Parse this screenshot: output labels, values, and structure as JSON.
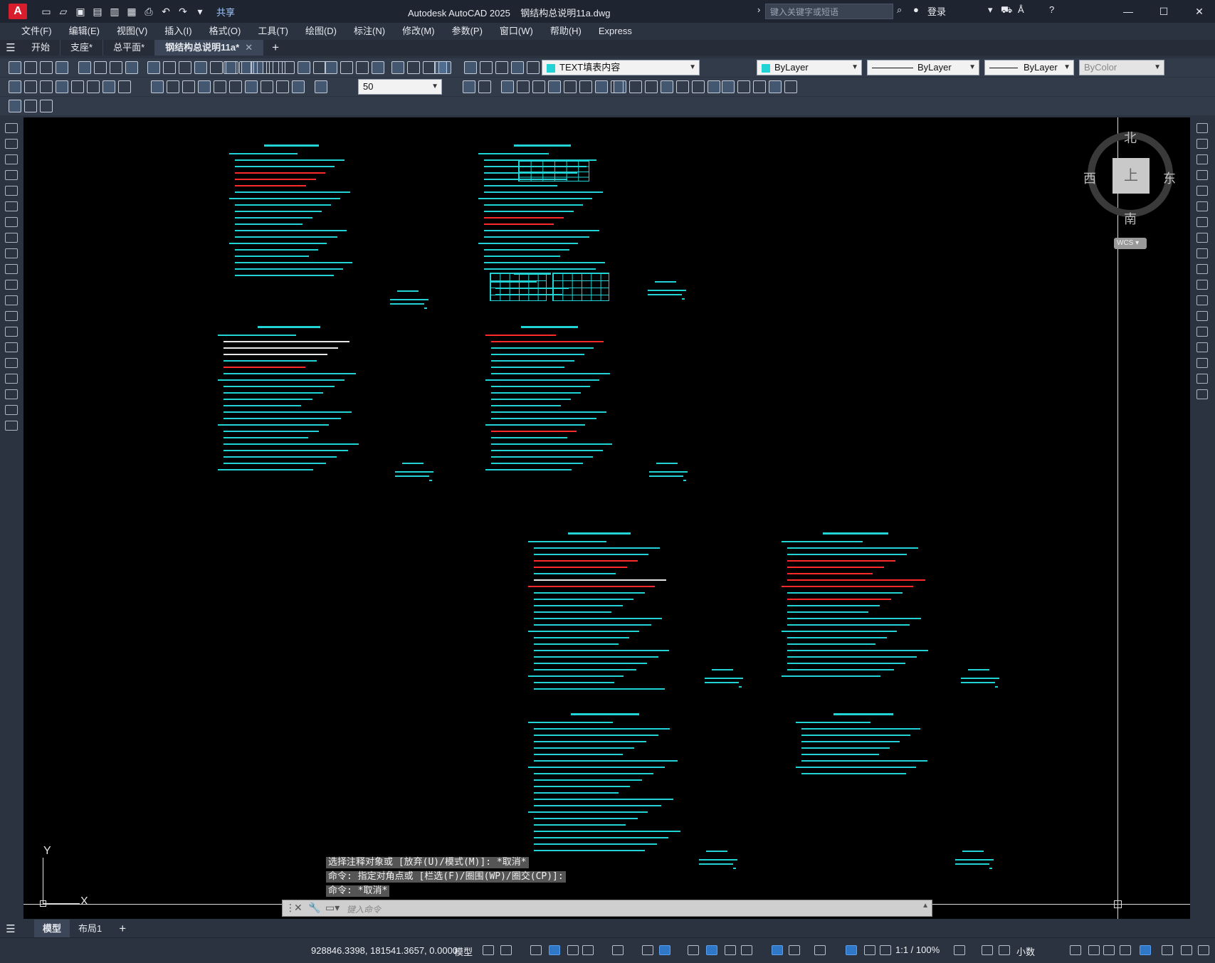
{
  "app": {
    "title": "Autodesk AutoCAD 2025",
    "filename": "钢结构总说明11a.dwg",
    "logo": "A",
    "share": "共享",
    "search_placeholder": "键入关键字或短语",
    "login": "登录"
  },
  "menu": [
    "文件(F)",
    "编辑(E)",
    "视图(V)",
    "插入(I)",
    "格式(O)",
    "工具(T)",
    "绘图(D)",
    "标注(N)",
    "修改(M)",
    "参数(P)",
    "窗口(W)",
    "帮助(H)",
    "Express"
  ],
  "file_tabs": [
    {
      "label": "开始",
      "active": false
    },
    {
      "label": "支座*",
      "active": false
    },
    {
      "label": "总平面*",
      "active": false
    },
    {
      "label": "钢结构总说明11a*",
      "active": true
    }
  ],
  "toolbar": {
    "layer": "TEXT填表内容",
    "color": "ByLayer",
    "linetype": "ByLayer",
    "lineweight": "ByLayer",
    "plotstyle": "ByColor",
    "dimscale": "50"
  },
  "viewcube": {
    "north": "北",
    "south": "南",
    "east": "东",
    "west": "西",
    "face": "上",
    "wcs": "WCS"
  },
  "ucs": {
    "x": "X",
    "y": "Y"
  },
  "command": {
    "history": [
      "选择注释对象或 [放弃(U)/模式(M)]: *取消*",
      "命令: 指定对角点或 [栏选(F)/圈围(WP)/圈交(CP)]:",
      "命令: *取消*"
    ],
    "placeholder": "键入命令"
  },
  "layout_tabs": [
    {
      "label": "模型",
      "active": true
    },
    {
      "label": "布局1",
      "active": false
    }
  ],
  "status": {
    "coords": "928846.3398, 181541.3657, 0.0000",
    "space": "模型",
    "scale": "1:1 / 100%",
    "units": "小数"
  }
}
